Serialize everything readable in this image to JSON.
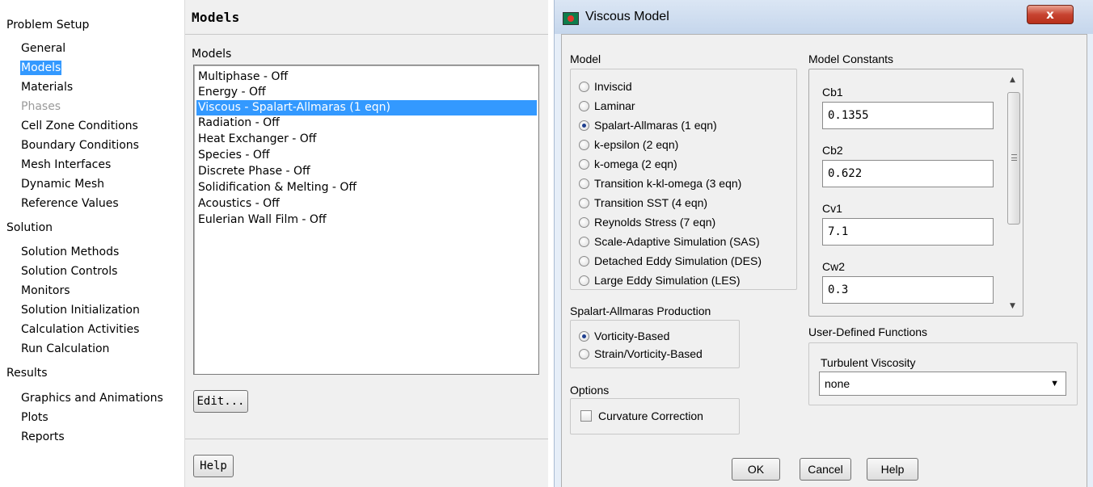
{
  "tree": {
    "sections": [
      {
        "label": "Problem Setup",
        "items": [
          {
            "label": "General",
            "state": "normal"
          },
          {
            "label": "Models",
            "state": "selected"
          },
          {
            "label": "Materials",
            "state": "normal"
          },
          {
            "label": "Phases",
            "state": "disabled"
          },
          {
            "label": "Cell Zone Conditions",
            "state": "normal"
          },
          {
            "label": "Boundary Conditions",
            "state": "normal"
          },
          {
            "label": "Mesh Interfaces",
            "state": "normal"
          },
          {
            "label": "Dynamic Mesh",
            "state": "normal"
          },
          {
            "label": "Reference Values",
            "state": "normal"
          }
        ]
      },
      {
        "label": "Solution",
        "items": [
          {
            "label": "Solution Methods",
            "state": "normal"
          },
          {
            "label": "Solution Controls",
            "state": "normal"
          },
          {
            "label": "Monitors",
            "state": "normal"
          },
          {
            "label": "Solution Initialization",
            "state": "normal"
          },
          {
            "label": "Calculation Activities",
            "state": "normal"
          },
          {
            "label": "Run Calculation",
            "state": "normal"
          }
        ]
      },
      {
        "label": "Results",
        "items": [
          {
            "label": "Graphics and Animations",
            "state": "normal"
          },
          {
            "label": "Plots",
            "state": "normal"
          },
          {
            "label": "Reports",
            "state": "normal"
          }
        ]
      }
    ]
  },
  "models_panel": {
    "title": "Models",
    "list_label": "Models",
    "items": [
      "Multiphase - Off",
      "Energy - Off",
      "Viscous - Spalart-Allmaras (1 eqn)",
      "Radiation - Off",
      "Heat Exchanger - Off",
      "Species - Off",
      "Discrete Phase - Off",
      "Solidification & Melting - Off",
      "Acoustics - Off",
      "Eulerian Wall Film - Off"
    ],
    "selected_index": 2,
    "edit_label": "Edit...",
    "help_label": "Help"
  },
  "dialog": {
    "title": "Viscous Model",
    "close_label": "x",
    "model_group_label": "Model",
    "model_options": [
      "Inviscid",
      "Laminar",
      "Spalart-Allmaras (1 eqn)",
      "k-epsilon (2 eqn)",
      "k-omega (2 eqn)",
      "Transition k-kl-omega (3 eqn)",
      "Transition SST (4 eqn)",
      "Reynolds Stress (7 eqn)",
      "Scale-Adaptive Simulation (SAS)",
      "Detached Eddy Simulation (DES)",
      "Large Eddy Simulation (LES)"
    ],
    "model_selected_index": 2,
    "production_group_label": "Spalart-Allmaras Production",
    "production_options": [
      "Vorticity-Based",
      "Strain/Vorticity-Based"
    ],
    "production_selected_index": 0,
    "options_group_label": "Options",
    "curvature_label": "Curvature Correction",
    "curvature_checked": false,
    "constants_label": "Model Constants",
    "constants": [
      {
        "name": "Cb1",
        "value": "0.1355"
      },
      {
        "name": "Cb2",
        "value": "0.622"
      },
      {
        "name": "Cv1",
        "value": "7.1"
      },
      {
        "name": "Cw2",
        "value": "0.3"
      }
    ],
    "udf_label": "User-Defined Functions",
    "turb_visc_label": "Turbulent Viscosity",
    "turb_visc_value": "none",
    "ok_label": "OK",
    "cancel_label": "Cancel",
    "help_label": "Help"
  }
}
